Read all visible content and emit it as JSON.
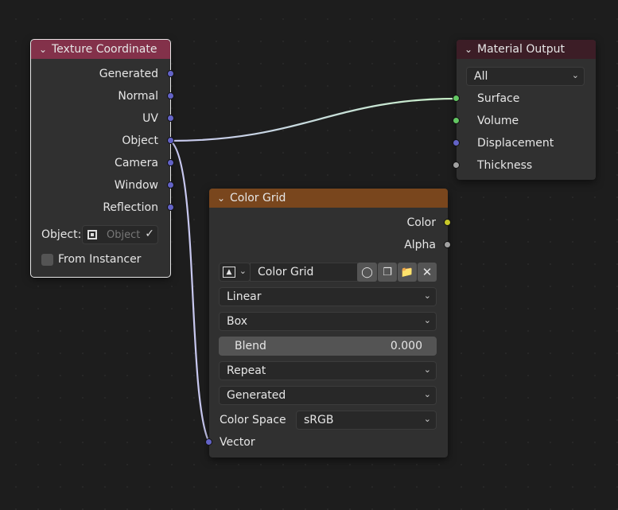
{
  "colors": {
    "background": "#1d1d1d",
    "node_body": "#303030",
    "header_input": "#83314a",
    "header_output": "#3c1d26",
    "header_texture": "#79461d",
    "socket_vector": "#6363c7",
    "socket_shader": "#63c763",
    "socket_float": "#a1a1a1",
    "socket_color": "#c7c729"
  },
  "texture_coordinate": {
    "title": "Texture Coordinate",
    "outputs": [
      "Generated",
      "Normal",
      "UV",
      "Object",
      "Camera",
      "Window",
      "Reflection"
    ],
    "object_label": "Object:",
    "object_placeholder": "Object",
    "from_instancer_label": "From Instancer",
    "from_instancer_checked": false
  },
  "material_output": {
    "title": "Material Output",
    "target": "All",
    "inputs": [
      "Surface",
      "Volume",
      "Displacement",
      "Thickness"
    ]
  },
  "color_grid": {
    "title": "Color Grid",
    "outputs": [
      "Color",
      "Alpha"
    ],
    "image_name": "Color Grid",
    "interpolation": "Linear",
    "projection": "Box",
    "blend_label": "Blend",
    "blend_value": "0.000",
    "extension": "Repeat",
    "source": "Generated",
    "color_space_label": "Color Space",
    "color_space": "sRGB",
    "input_vector": "Vector"
  }
}
